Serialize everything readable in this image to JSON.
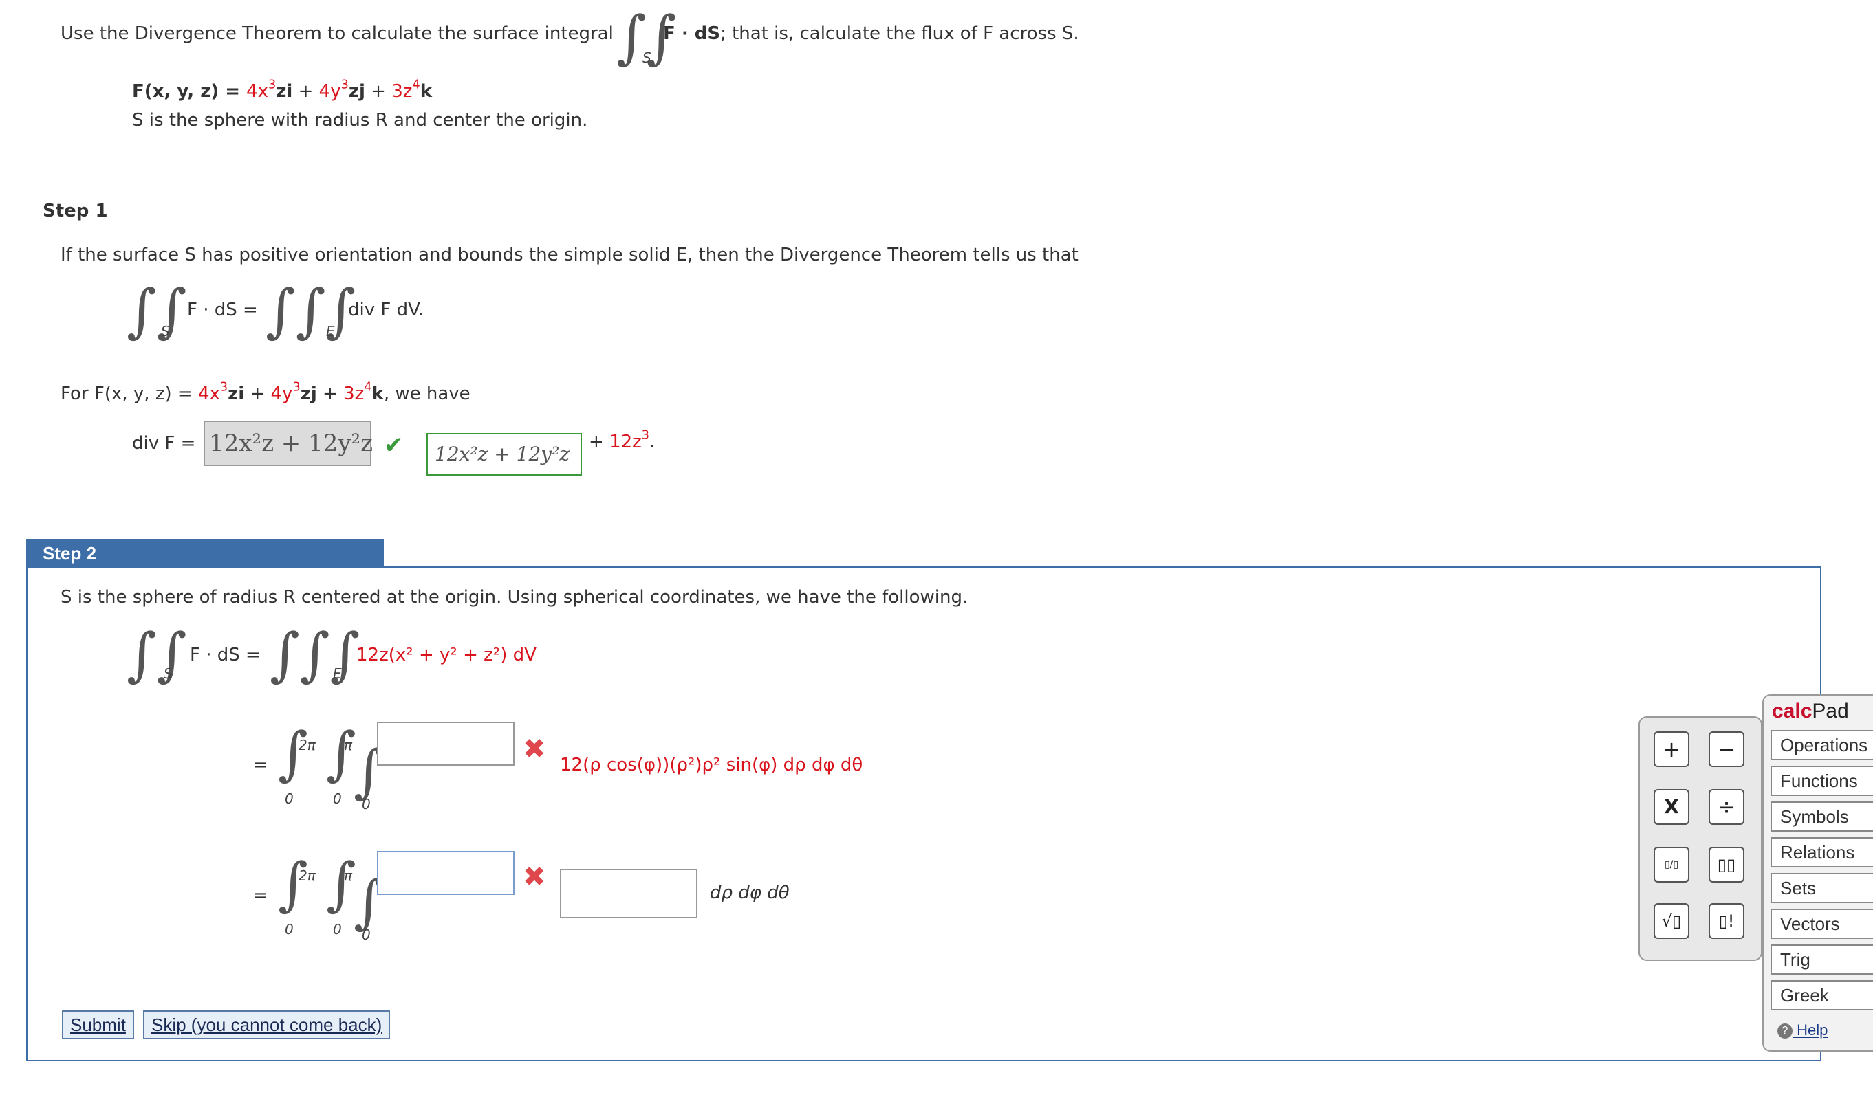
{
  "intro": {
    "text_before": "Use the Divergence Theorem to calculate the surface integral",
    "integrand": "F · dS",
    "surface_sub": "S",
    "text_after": "; that is, calculate the flux of F across S."
  },
  "field": {
    "lhs": "F(x, y, z) = ",
    "term1_coef": "4x",
    "term1_exp": "3",
    "term1_tail": "zi",
    "term2_coef": "4y",
    "term2_exp": "3",
    "term2_tail": "zj",
    "term3_coef": "3z",
    "term3_exp": "4",
    "term3_tail": "k",
    "plus": " + "
  },
  "surface_desc": "S is the sphere with radius R and center the origin.",
  "step1": {
    "label": "Step 1",
    "text": "If the surface S has positive orientation and bounds the simple solid E, then the Divergence Theorem tells us that",
    "lhs": "F · dS =",
    "lhs_sub": "S",
    "rhs": "div F dV.",
    "rhs_sub": "E",
    "for_text_start": "For F(x, y, z) = ",
    "for_text_end": ", we have",
    "div_label": "div F =",
    "answer_value": "12x²z + 12y²z",
    "correct_display": "12x²z + 12y²z",
    "tail_plus": "+",
    "tail_term": "12z",
    "tail_exp": "3",
    "tail_period": "."
  },
  "step2": {
    "label": "Step 2",
    "text": "S is the sphere of radius R centered at the origin. Using spherical coordinates, we have the following.",
    "lhs": "F · dS =",
    "lhs_sub": "S",
    "rhs_sub": "E",
    "rhs_integrand": "12z(x² + y² + z²) dV",
    "eq": "=",
    "upper_theta": "2π",
    "upper_phi": "π",
    "lower": "0",
    "row1_answer": "",
    "row1_integrand": "12(ρ cos(φ))(ρ²)ρ² sin(φ) dρ dφ dθ",
    "row2_answer": "",
    "row2_box2": "",
    "row2_tail": "dρ dφ dθ",
    "mark": "✖",
    "check": "✔"
  },
  "buttons": {
    "submit": "Submit",
    "skip": "Skip (you cannot come back)"
  },
  "calcpad": {
    "title_calc": "calc",
    "title_pad": "Pad",
    "keys": [
      "+",
      "−",
      "X",
      "÷",
      "▯/▯",
      "▯▯",
      "√▯",
      "▯!"
    ],
    "tabs": [
      "Operations",
      "Functions",
      "Symbols",
      "Relations",
      "Sets",
      "Vectors",
      "Trig",
      "Greek"
    ],
    "help": "Help"
  },
  "colors": {
    "accent_blue": "#3e6ea8",
    "error_red": "#e0474c",
    "correct_green": "#3a9a3a",
    "variable_red": "#d9141c"
  }
}
